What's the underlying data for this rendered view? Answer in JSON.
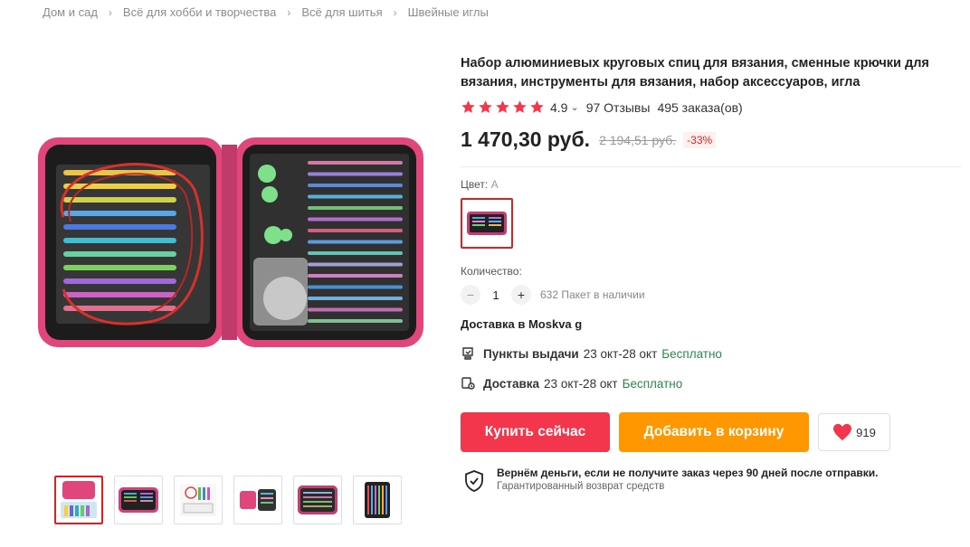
{
  "breadcrumb": {
    "items": [
      "Дом и сад",
      "Всё для хобби и творчества",
      "Всё для шитья",
      "Швейные иглы"
    ],
    "separator": "›"
  },
  "product": {
    "title": "Набор алюминиевых круговых спиц для вязания, сменные крючки для вязания, инструменты для вязания, набор аксессуаров, игла",
    "rating": "4.9",
    "rating_stars": 5,
    "reviews": "97 Отзывы",
    "orders": "495 заказа(ов)",
    "price": "1 470,30 руб.",
    "old_price": "2 194,51 руб.",
    "discount": "-33%",
    "color_label": "Цвет:",
    "color_value": "A",
    "quantity_label": "Количество:",
    "quantity": "1",
    "stock": "632 Пакет в наличии"
  },
  "delivery": {
    "title": "Доставка в Moskva g",
    "options": [
      {
        "name": "Пункты выдачи",
        "dates": "23 окт-28 окт",
        "price": "Бесплатно"
      },
      {
        "name": "Доставка",
        "dates": "23 окт-28 окт",
        "price": "Бесплатно"
      }
    ]
  },
  "actions": {
    "buy_label": "Купить сейчас",
    "cart_label": "Добавить в корзину",
    "wish_count": "919"
  },
  "guarantee": {
    "title": "Вернём деньги, если не получите заказ через 90 дней после отправки.",
    "subtitle": "Гарантированный возврат средств"
  },
  "colors": {
    "accent": "#f4364c",
    "cart": "#ff9800",
    "star": "#f4364c",
    "free": "#2a8a4a",
    "case_pink": "#e0457b"
  },
  "icons": {
    "qty_minus": "−",
    "qty_plus": "+",
    "chevron": "⌄"
  }
}
